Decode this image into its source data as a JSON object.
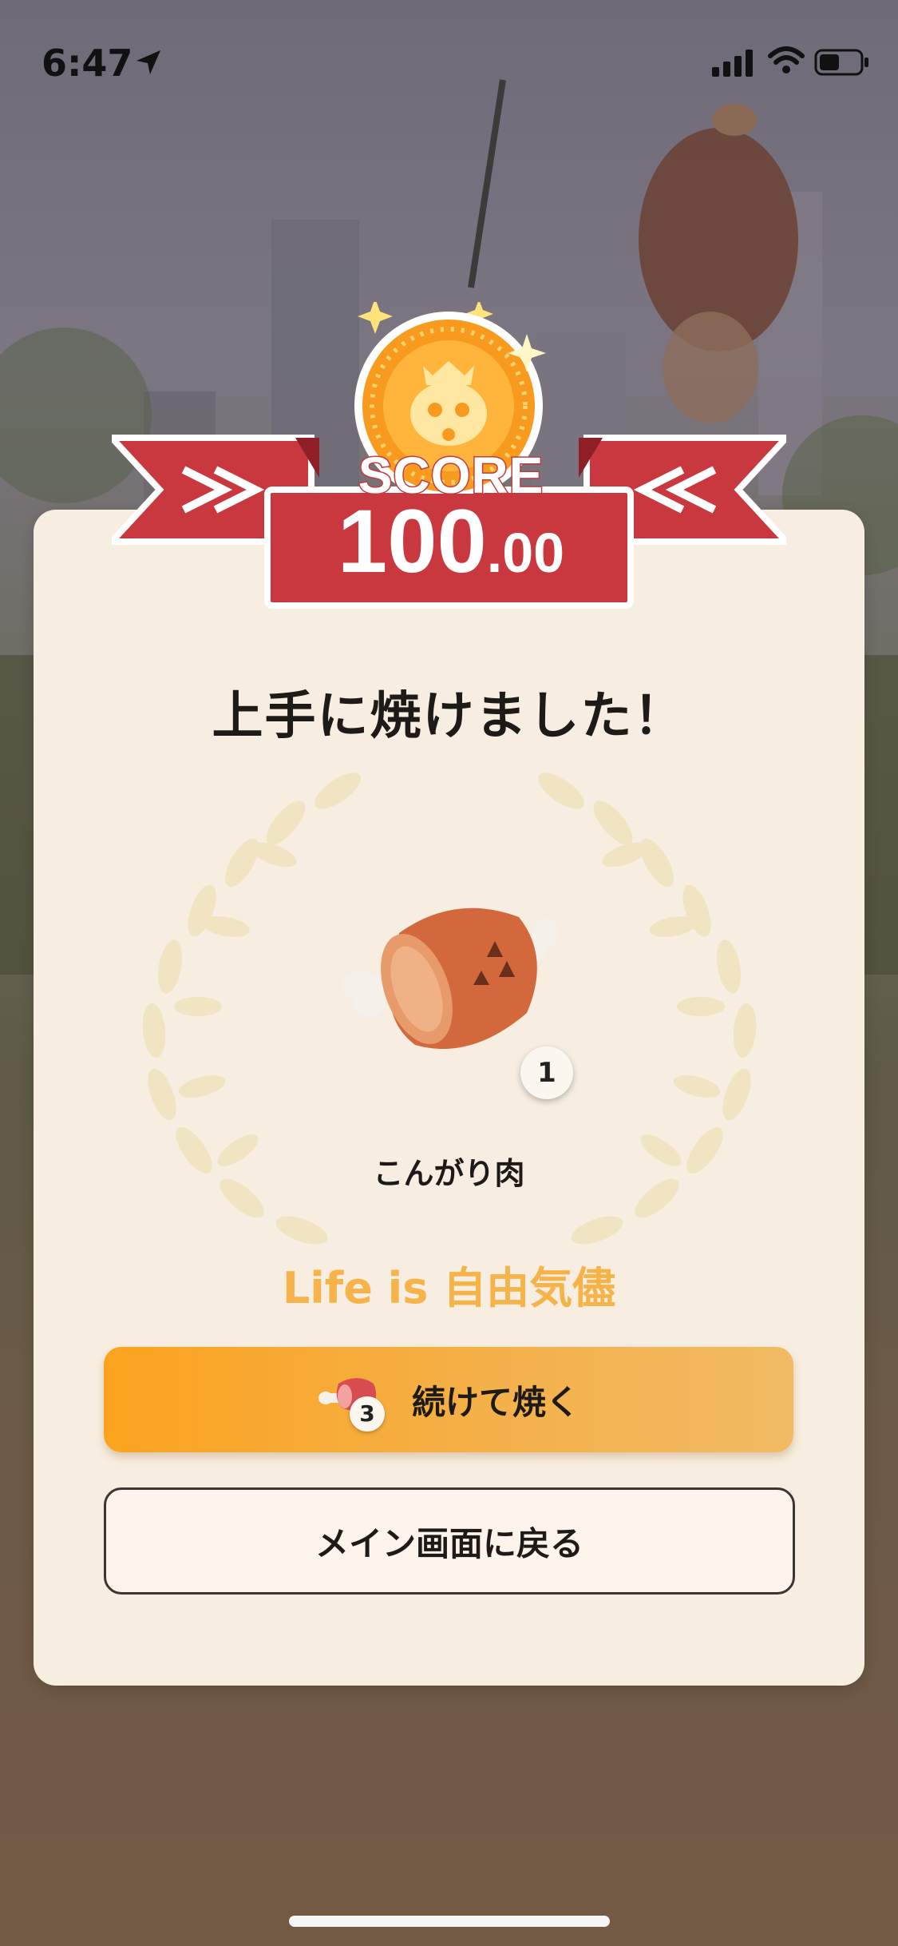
{
  "status_bar": {
    "time": "6:47"
  },
  "score": {
    "label": "SCORE",
    "integer": "100",
    "decimal": ".00"
  },
  "result": {
    "headline": "上手に焼けました！",
    "item_name": "こんがり肉",
    "item_quantity": "1",
    "tagline": "Life is 自由気儘"
  },
  "buttons": {
    "continue": {
      "label": "続けて焼く",
      "cost_count": "3"
    },
    "back": {
      "label": "メイン画面に戻る"
    }
  },
  "colors": {
    "card": "#f7ede0",
    "accent_orange": "#fba31e",
    "ribbon_red": "#c9383f",
    "tagline": "#f5b34a"
  }
}
